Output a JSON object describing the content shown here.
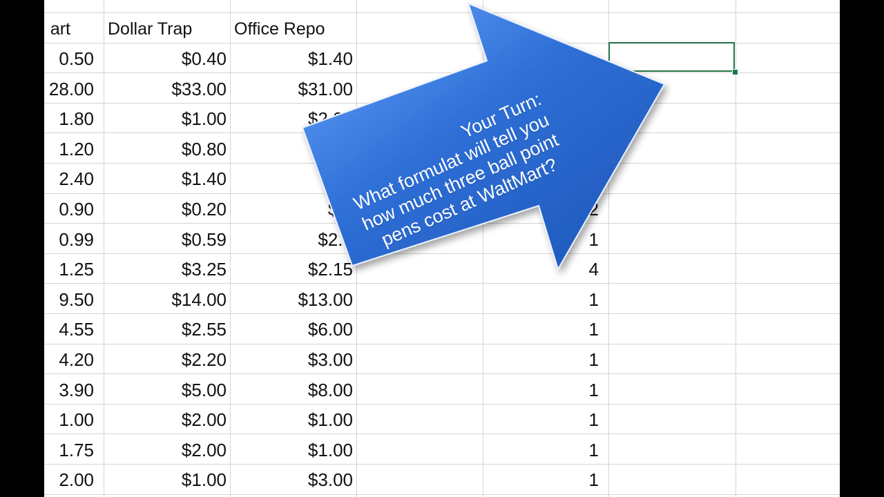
{
  "headers": [
    "art",
    "Dollar Trap",
    "Office Repo"
  ],
  "rows": [
    [
      "0.50",
      "$0.40",
      "$1.40",
      ""
    ],
    [
      "28.00",
      "$33.00",
      "$31.00",
      ""
    ],
    [
      "1.80",
      "$1.00",
      "$2.00",
      ""
    ],
    [
      "1.20",
      "$0.80",
      "$",
      ""
    ],
    [
      "2.40",
      "$1.40",
      "$2",
      ""
    ],
    [
      "0.90",
      "$0.20",
      "$0.",
      "2"
    ],
    [
      "0.99",
      "$0.59",
      "$2.5",
      "1"
    ],
    [
      "1.25",
      "$3.25",
      "$2.15",
      "4"
    ],
    [
      "9.50",
      "$14.00",
      "$13.00",
      "1"
    ],
    [
      "4.55",
      "$2.55",
      "$6.00",
      "1"
    ],
    [
      "4.20",
      "$2.20",
      "$3.00",
      "1"
    ],
    [
      "3.90",
      "$5.00",
      "$8.00",
      "1"
    ],
    [
      "1.00",
      "$2.00",
      "$1.00",
      "1"
    ],
    [
      "1.75",
      "$2.00",
      "$1.00",
      "1"
    ],
    [
      "2.00",
      "$1.00",
      "$3.00",
      "1"
    ]
  ],
  "callout": {
    "title": "Your Turn:",
    "lines": [
      "What formulat will tell you",
      "how much three ball point",
      "pens cost at WaltMart?"
    ]
  },
  "colors": {
    "arrow": "#2e6fd6",
    "selection": "#217346",
    "grid": "#d4d4d4"
  }
}
